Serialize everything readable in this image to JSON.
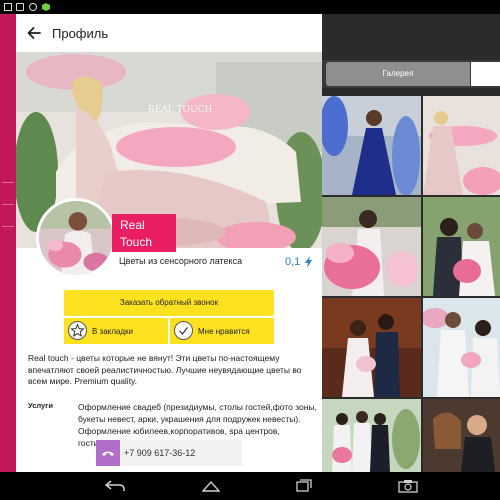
{
  "appbar": {
    "title": "Профиль"
  },
  "hero": {
    "watermark": "REAL TOUCH"
  },
  "profile": {
    "brand_line1": "Real",
    "brand_line2": "Touch",
    "subtitle": "Цветы из сенсорного латекса",
    "rating": "0,1"
  },
  "actions": {
    "callback_label": "Заказать обратный звонок",
    "favorites_label": "В закладки",
    "like_label": "Мне нравится"
  },
  "description": "Real touch - цветы которые не вянут!  Эти цветы по-настоящему впечатляют своей реалистичностью. Лучшие неувядающие цветы во всем мире. Premium quality.",
  "services": {
    "label": "Услуги",
    "text": "Оформление свадеб (президиумы, столы гостей,фото зоны, букеты невест, арки, украшения для подружек невесты). Оформление  юбилеев,корпоративов, spa центров, гостиниц."
  },
  "contact": {
    "phone": "+7 909 617-36-12"
  },
  "gallery": {
    "tab_label": "Галерея"
  },
  "colors": {
    "accent_pink": "#e91e63",
    "strip_magenta": "#c2185b",
    "button_yellow": "#ffe21f",
    "phone_purple": "#b06ec8",
    "rating_blue": "#2a7fd4"
  },
  "icons": [
    "back-arrow-icon",
    "bolt-icon",
    "star-icon",
    "check-icon",
    "phone-icon",
    "nav-back-icon",
    "nav-home-icon",
    "nav-recent-icon",
    "nav-screenshot-icon"
  ]
}
